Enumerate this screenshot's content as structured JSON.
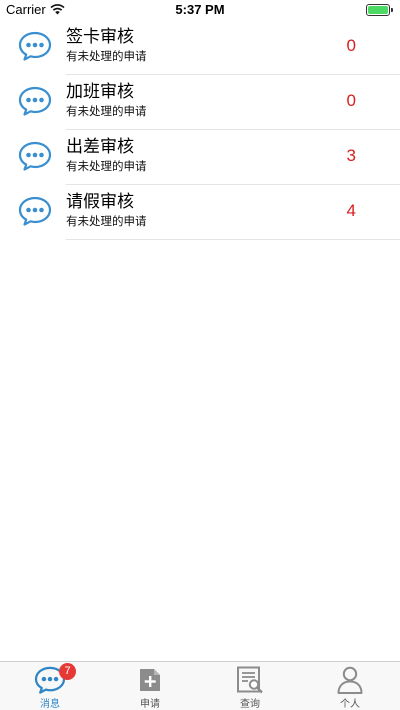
{
  "status_bar": {
    "carrier": "Carrier",
    "time": "5:37 PM",
    "battery_level": 1.0,
    "battery_color": "#4cd964"
  },
  "list": {
    "items": [
      {
        "title": "签卡审核",
        "subtitle": "有未处理的申请",
        "count": "0",
        "icon": "chat-bubble-icon"
      },
      {
        "title": "加班审核",
        "subtitle": "有未处理的申请",
        "count": "0",
        "icon": "chat-bubble-icon"
      },
      {
        "title": "出差审核",
        "subtitle": "有未处理的申请",
        "count": "3",
        "icon": "chat-bubble-icon"
      },
      {
        "title": "请假审核",
        "subtitle": "有未处理的申请",
        "count": "4",
        "icon": "chat-bubble-icon"
      }
    ],
    "count_color": "#d81e1e"
  },
  "tab_bar": {
    "tabs": [
      {
        "label": "消息",
        "icon": "chat-bubble-icon",
        "active": true,
        "badge": "7"
      },
      {
        "label": "申请",
        "icon": "add-document-icon",
        "active": false
      },
      {
        "label": "查询",
        "icon": "search-document-icon",
        "active": false
      },
      {
        "label": "个人",
        "icon": "person-icon",
        "active": false
      }
    ],
    "active_color": "#2f86c7",
    "badge_color": "#e53935"
  }
}
